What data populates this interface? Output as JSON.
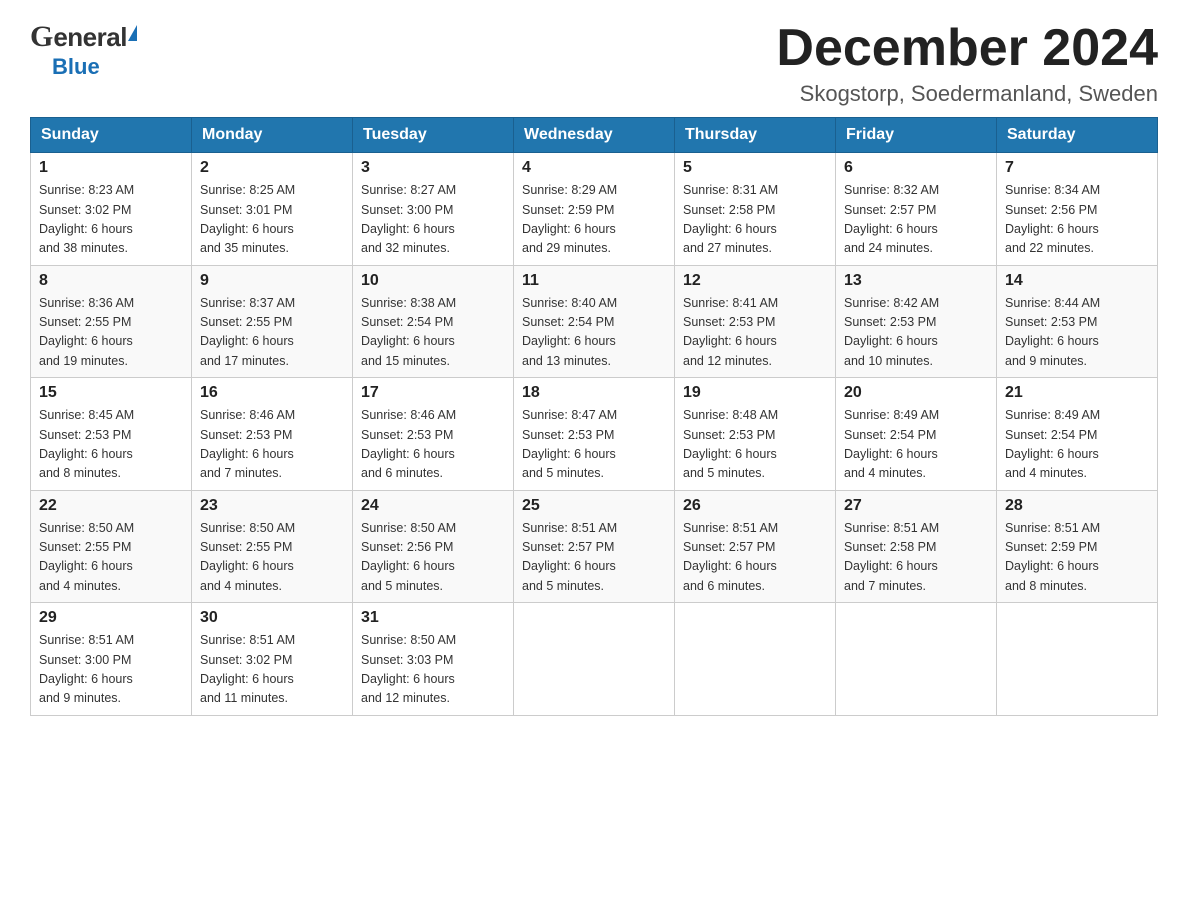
{
  "header": {
    "month_title": "December 2024",
    "location": "Skogstorp, Soedermanland, Sweden",
    "logo_general": "General",
    "logo_blue": "Blue"
  },
  "columns": [
    "Sunday",
    "Monday",
    "Tuesday",
    "Wednesday",
    "Thursday",
    "Friday",
    "Saturday"
  ],
  "weeks": [
    [
      {
        "day": "1",
        "info": "Sunrise: 8:23 AM\nSunset: 3:02 PM\nDaylight: 6 hours\nand 38 minutes."
      },
      {
        "day": "2",
        "info": "Sunrise: 8:25 AM\nSunset: 3:01 PM\nDaylight: 6 hours\nand 35 minutes."
      },
      {
        "day": "3",
        "info": "Sunrise: 8:27 AM\nSunset: 3:00 PM\nDaylight: 6 hours\nand 32 minutes."
      },
      {
        "day": "4",
        "info": "Sunrise: 8:29 AM\nSunset: 2:59 PM\nDaylight: 6 hours\nand 29 minutes."
      },
      {
        "day": "5",
        "info": "Sunrise: 8:31 AM\nSunset: 2:58 PM\nDaylight: 6 hours\nand 27 minutes."
      },
      {
        "day": "6",
        "info": "Sunrise: 8:32 AM\nSunset: 2:57 PM\nDaylight: 6 hours\nand 24 minutes."
      },
      {
        "day": "7",
        "info": "Sunrise: 8:34 AM\nSunset: 2:56 PM\nDaylight: 6 hours\nand 22 minutes."
      }
    ],
    [
      {
        "day": "8",
        "info": "Sunrise: 8:36 AM\nSunset: 2:55 PM\nDaylight: 6 hours\nand 19 minutes."
      },
      {
        "day": "9",
        "info": "Sunrise: 8:37 AM\nSunset: 2:55 PM\nDaylight: 6 hours\nand 17 minutes."
      },
      {
        "day": "10",
        "info": "Sunrise: 8:38 AM\nSunset: 2:54 PM\nDaylight: 6 hours\nand 15 minutes."
      },
      {
        "day": "11",
        "info": "Sunrise: 8:40 AM\nSunset: 2:54 PM\nDaylight: 6 hours\nand 13 minutes."
      },
      {
        "day": "12",
        "info": "Sunrise: 8:41 AM\nSunset: 2:53 PM\nDaylight: 6 hours\nand 12 minutes."
      },
      {
        "day": "13",
        "info": "Sunrise: 8:42 AM\nSunset: 2:53 PM\nDaylight: 6 hours\nand 10 minutes."
      },
      {
        "day": "14",
        "info": "Sunrise: 8:44 AM\nSunset: 2:53 PM\nDaylight: 6 hours\nand 9 minutes."
      }
    ],
    [
      {
        "day": "15",
        "info": "Sunrise: 8:45 AM\nSunset: 2:53 PM\nDaylight: 6 hours\nand 8 minutes."
      },
      {
        "day": "16",
        "info": "Sunrise: 8:46 AM\nSunset: 2:53 PM\nDaylight: 6 hours\nand 7 minutes."
      },
      {
        "day": "17",
        "info": "Sunrise: 8:46 AM\nSunset: 2:53 PM\nDaylight: 6 hours\nand 6 minutes."
      },
      {
        "day": "18",
        "info": "Sunrise: 8:47 AM\nSunset: 2:53 PM\nDaylight: 6 hours\nand 5 minutes."
      },
      {
        "day": "19",
        "info": "Sunrise: 8:48 AM\nSunset: 2:53 PM\nDaylight: 6 hours\nand 5 minutes."
      },
      {
        "day": "20",
        "info": "Sunrise: 8:49 AM\nSunset: 2:54 PM\nDaylight: 6 hours\nand 4 minutes."
      },
      {
        "day": "21",
        "info": "Sunrise: 8:49 AM\nSunset: 2:54 PM\nDaylight: 6 hours\nand 4 minutes."
      }
    ],
    [
      {
        "day": "22",
        "info": "Sunrise: 8:50 AM\nSunset: 2:55 PM\nDaylight: 6 hours\nand 4 minutes."
      },
      {
        "day": "23",
        "info": "Sunrise: 8:50 AM\nSunset: 2:55 PM\nDaylight: 6 hours\nand 4 minutes."
      },
      {
        "day": "24",
        "info": "Sunrise: 8:50 AM\nSunset: 2:56 PM\nDaylight: 6 hours\nand 5 minutes."
      },
      {
        "day": "25",
        "info": "Sunrise: 8:51 AM\nSunset: 2:57 PM\nDaylight: 6 hours\nand 5 minutes."
      },
      {
        "day": "26",
        "info": "Sunrise: 8:51 AM\nSunset: 2:57 PM\nDaylight: 6 hours\nand 6 minutes."
      },
      {
        "day": "27",
        "info": "Sunrise: 8:51 AM\nSunset: 2:58 PM\nDaylight: 6 hours\nand 7 minutes."
      },
      {
        "day": "28",
        "info": "Sunrise: 8:51 AM\nSunset: 2:59 PM\nDaylight: 6 hours\nand 8 minutes."
      }
    ],
    [
      {
        "day": "29",
        "info": "Sunrise: 8:51 AM\nSunset: 3:00 PM\nDaylight: 6 hours\nand 9 minutes."
      },
      {
        "day": "30",
        "info": "Sunrise: 8:51 AM\nSunset: 3:02 PM\nDaylight: 6 hours\nand 11 minutes."
      },
      {
        "day": "31",
        "info": "Sunrise: 8:50 AM\nSunset: 3:03 PM\nDaylight: 6 hours\nand 12 minutes."
      },
      {
        "day": "",
        "info": ""
      },
      {
        "day": "",
        "info": ""
      },
      {
        "day": "",
        "info": ""
      },
      {
        "day": "",
        "info": ""
      }
    ]
  ]
}
